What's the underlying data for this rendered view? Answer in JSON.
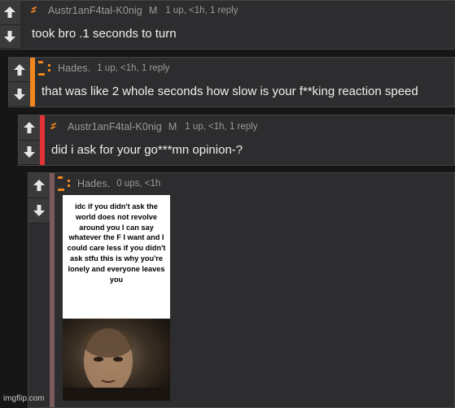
{
  "comments": [
    {
      "username": "Austr1anF4tal-K0nig",
      "badge": "M",
      "meta": "1 up, <1h, 1 reply",
      "text": "took bro .1 seconds to turn",
      "accent_color": "#2b2b2b"
    },
    {
      "username": "Hades.",
      "badge": "",
      "meta": "1 up, <1h, 1 reply",
      "text": "that was like 2 whole seconds how slow is your f**king reaction speed",
      "accent_color": "#f0861e"
    },
    {
      "username": "Austr1anF4tal-K0nig",
      "badge": "M",
      "meta": "1 up, <1h, 1 reply",
      "text": "did i ask for your go***mn opinion-?",
      "accent_color": "#e23434"
    },
    {
      "username": "Hades.",
      "badge": "",
      "meta": "0 ups, <1h",
      "text": "",
      "accent_color": "#7a5a5a"
    }
  ],
  "meme": {
    "caption": "idc if you didn't ask the world does not revolve around you I can say whatever the F I want and I could care less if you didn't ask stfu this is why you're lonely and everyone leaves you"
  },
  "watermark": "imgflip.com",
  "colors": {
    "hades_avatar": "#f0861e",
    "austrian_avatar": "#f0861e"
  }
}
